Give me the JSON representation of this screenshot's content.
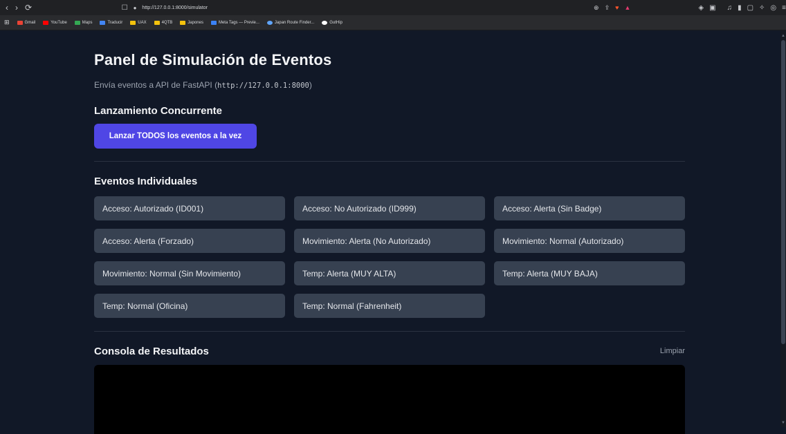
{
  "browser": {
    "back": "‹",
    "forward": "›",
    "reload": "⟳",
    "url": "http://127.0.0.1:8000/simulator",
    "bookmarks": [
      {
        "label": "Gmail",
        "color": "#ea4335"
      },
      {
        "label": "YouTube",
        "color": "#ff0000"
      },
      {
        "label": "Maps",
        "color": "#34a853"
      },
      {
        "label": "Traducir",
        "color": "#4285f4"
      },
      {
        "label": "UAX",
        "color": "#f4c20d"
      },
      {
        "label": "4QTB",
        "color": "#f4c20d"
      },
      {
        "label": "Japones",
        "color": "#f4c20d"
      },
      {
        "label": "Meta Tags — Previe...",
        "color": "#3b82f6"
      },
      {
        "label": "Japan Route Finder...",
        "color": "#60a5fa"
      },
      {
        "label": "GutHip",
        "color": "#ffffff"
      }
    ]
  },
  "page": {
    "title": "Panel de Simulación de Eventos",
    "subtitle_prefix": "Envía eventos a API de FastAPI (",
    "subtitle_code": "http://127.0.0.1:8000",
    "subtitle_suffix": ")"
  },
  "concurrent": {
    "heading": "Lanzamiento Concurrente",
    "button_label": "Lanzar TODOS los eventos a la vez"
  },
  "individual": {
    "heading": "Eventos Individuales",
    "events": [
      "Acceso: Autorizado (ID001)",
      "Acceso: No Autorizado (ID999)",
      "Acceso: Alerta (Sin Badge)",
      "Acceso: Alerta (Forzado)",
      "Movimiento: Alerta (No Autorizado)",
      "Movimiento: Normal (Autorizado)",
      "Movimiento: Normal (Sin Movimiento)",
      "Temp: Alerta (MUY ALTA)",
      "Temp: Alerta (MUY BAJA)",
      "Temp: Normal (Oficina)",
      "Temp: Normal (Fahrenheit)"
    ]
  },
  "console": {
    "heading": "Consola de Resultados",
    "clear_label": "Limpiar"
  },
  "colors": {
    "background": "#111827",
    "accent": "#4f46e5",
    "event_button": "#374151",
    "console": "#000000"
  }
}
